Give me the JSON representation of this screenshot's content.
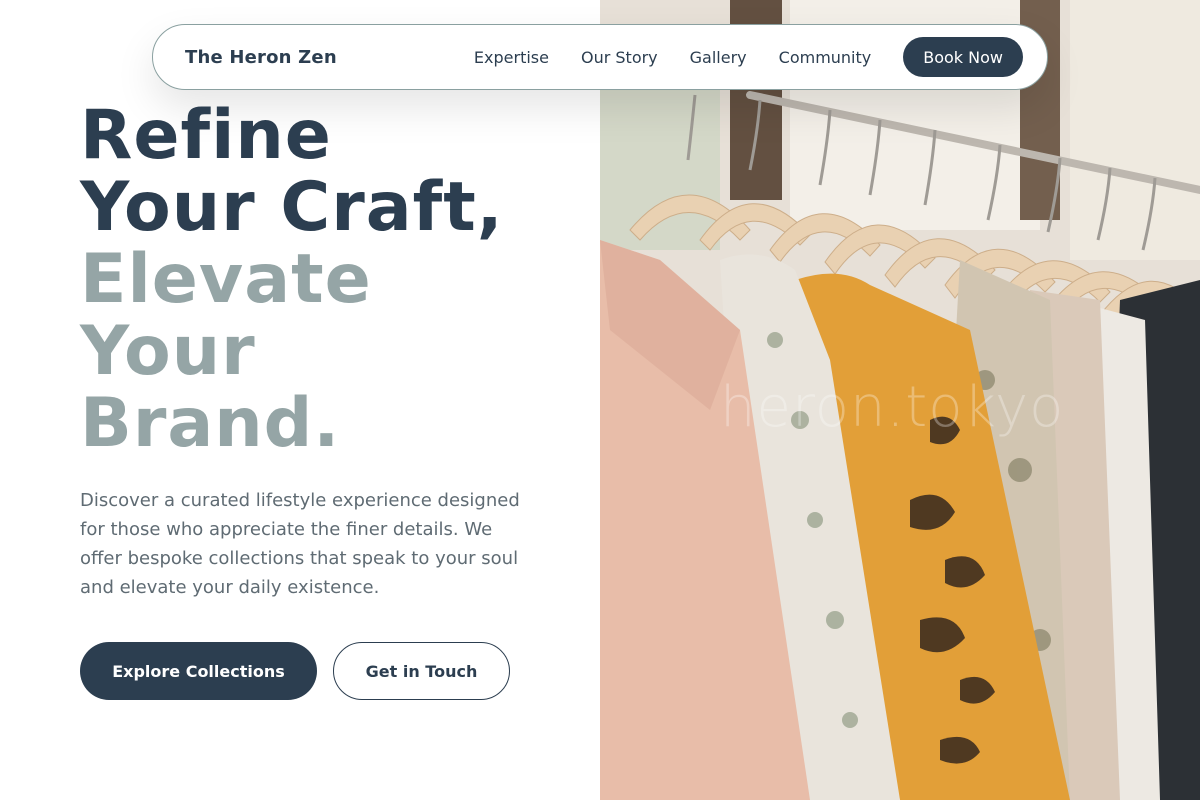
{
  "nav": {
    "brand": "The Heron Zen",
    "links": [
      "Expertise",
      "Our Story",
      "Gallery",
      "Community"
    ],
    "cta": "Book Now"
  },
  "hero": {
    "headline_dark": [
      "Refine",
      "Your Craft,"
    ],
    "headline_muted": [
      "Elevate",
      "Your",
      "Brand."
    ],
    "lead": "Discover a curated lifestyle experience designed for those who appreciate the finer details. We offer bespoke collections that speak to your soul and elevate your daily existence.",
    "primary_cta": "Explore Collections",
    "secondary_cta": "Get in Touch"
  },
  "image": {
    "watermark": "heron.tokyo",
    "subject": "clothing rack with hanging garments"
  },
  "colors": {
    "primary": "#2c3e50",
    "muted": "#95a5a6",
    "body_text": "#5f6b73",
    "nav_border": "#8aa0a0"
  }
}
